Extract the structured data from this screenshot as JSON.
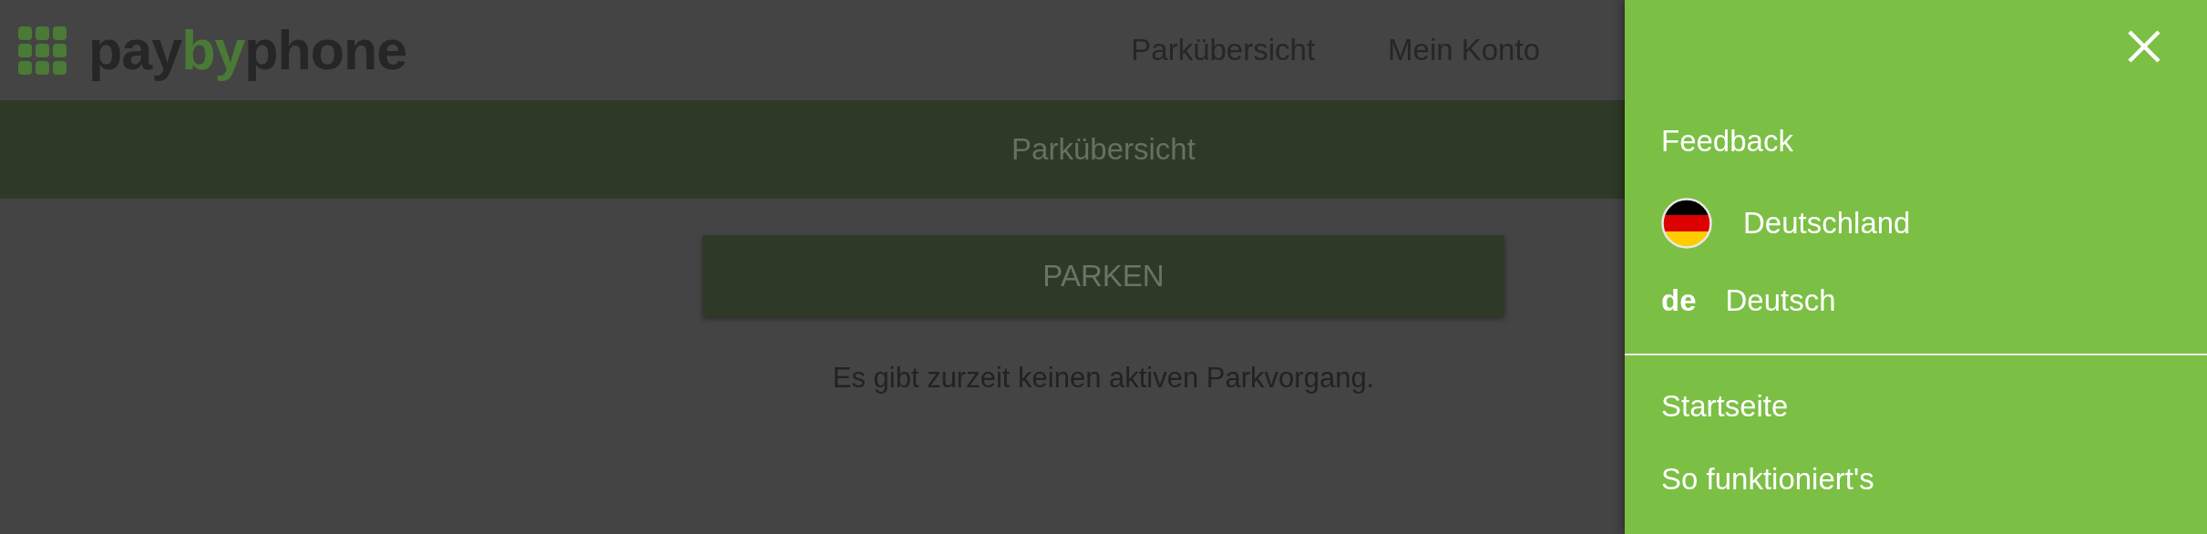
{
  "header": {
    "logo": {
      "parts": [
        {
          "text": "pay",
          "accent": false
        },
        {
          "text": "by",
          "accent": true
        },
        {
          "text": "phone",
          "accent": false
        }
      ]
    },
    "nav": [
      "Parkübersicht",
      "Mein Konto"
    ]
  },
  "page": {
    "title": "Parkübersicht",
    "primary_button": "PARKEN",
    "message": "Es gibt zurzeit keinen aktiven Parkvorgang."
  },
  "drawer": {
    "open": true,
    "items": [
      {
        "kind": "link",
        "label": "Feedback"
      },
      {
        "kind": "country",
        "label": "Deutschland"
      },
      {
        "kind": "language",
        "code": "de",
        "label": "Deutsch"
      },
      {
        "kind": "divider"
      },
      {
        "kind": "link",
        "label": "Startseite"
      },
      {
        "kind": "link",
        "label": "So funktioniert's"
      }
    ]
  }
}
